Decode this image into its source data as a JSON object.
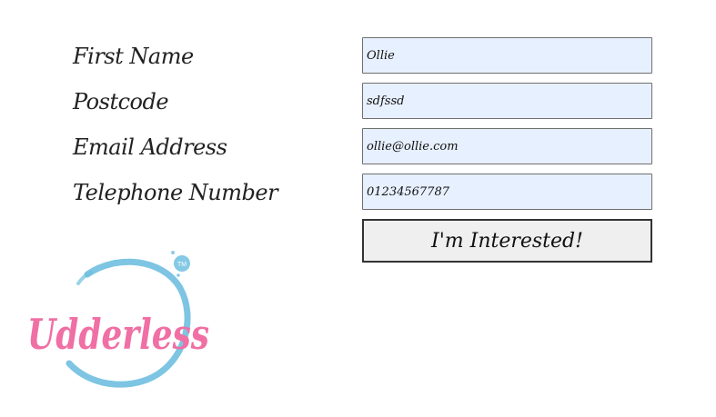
{
  "form": {
    "fields": [
      {
        "label": "First Name",
        "value": "Ollie"
      },
      {
        "label": "Postcode",
        "value": "sdfssd"
      },
      {
        "label": "Email Address",
        "value": "ollie@ollie.com"
      },
      {
        "label": "Telephone Number",
        "value": "01234567787"
      }
    ],
    "submit_label": "I'm Interested!"
  },
  "logo": {
    "text": "Udderless",
    "trademark": "TM",
    "pink": "#f06fa4",
    "blue": "#6fbfe0"
  },
  "colors": {
    "field_bg": "#e7f0fe",
    "button_bg": "#efefef",
    "text": "#222222"
  }
}
